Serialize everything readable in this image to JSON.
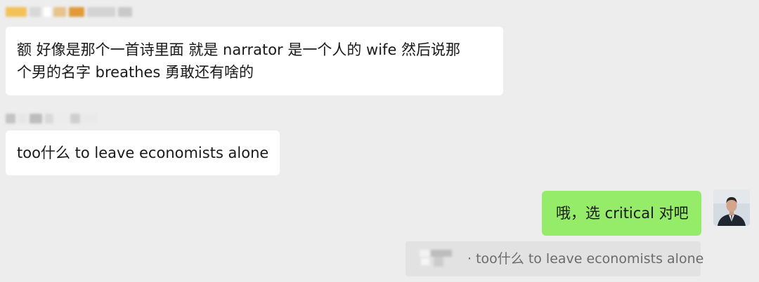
{
  "messages": [
    {
      "direction": "incoming",
      "lines": [
        "额 好像是那个一首诗里面 就是 narrator 是一个人的 wife 然后说那",
        "个男的名字 breathes 勇敢还有啥的"
      ]
    },
    {
      "direction": "incoming",
      "lines": [
        "too什么 to leave economists alone"
      ]
    },
    {
      "direction": "outgoing",
      "lines": [
        "哦，选 critical 对吧"
      ]
    }
  ],
  "quoted_reply": {
    "text": "· too什么 to leave economists alone"
  },
  "colors": {
    "background": "#ededed",
    "incoming_bubble": "#ffffff",
    "outgoing_bubble": "#95ec69",
    "quote_background": "#e2e2e2",
    "quote_text": "#6b6b6b"
  },
  "icons": {
    "avatar": "user-avatar-photo"
  }
}
